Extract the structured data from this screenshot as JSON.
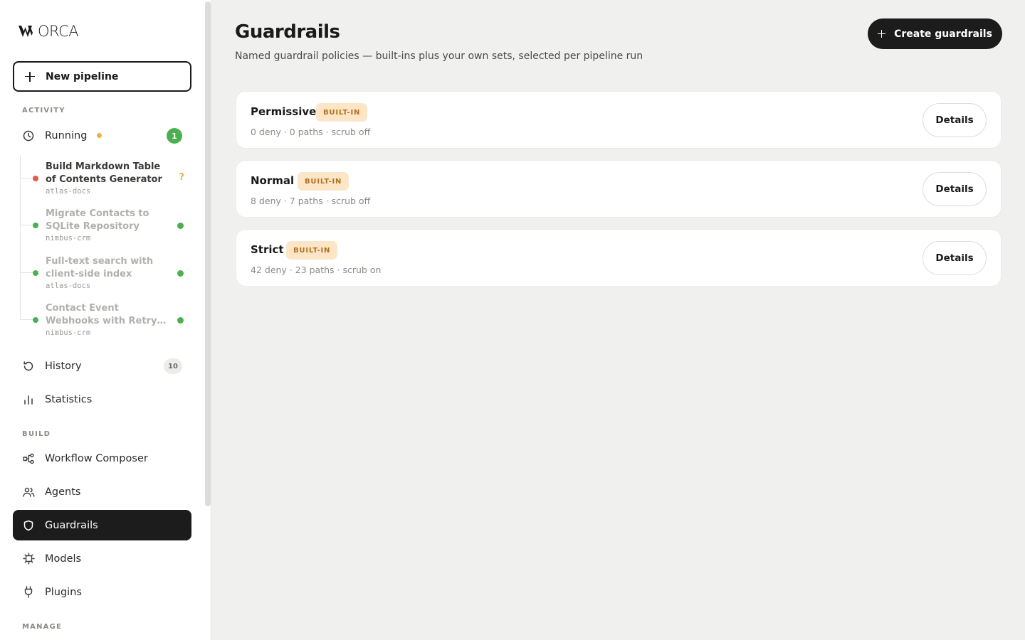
{
  "app": {
    "logo_text": "ORCA"
  },
  "sidebar": {
    "new_pipeline_label": "New pipeline",
    "sections": {
      "activity": "ACTIVITY",
      "build": "BUILD",
      "manage": "MANAGE"
    },
    "running": {
      "label": "Running",
      "count": "1"
    },
    "runs": [
      {
        "title": "Build Markdown Table of Contents Generator",
        "project": "atlas-docs",
        "status": "error",
        "indicator": "?"
      },
      {
        "title": "Migrate Contacts to SQLite Repository",
        "project": "nimbus-crm",
        "status": "ok"
      },
      {
        "title": "Full-text search with client-side index",
        "project": "atlas-docs",
        "status": "ok"
      },
      {
        "title": "Contact Event Webhooks with Retry…",
        "project": "nimbus-crm",
        "status": "ok"
      }
    ],
    "history": {
      "label": "History",
      "count": "10"
    },
    "statistics": {
      "label": "Statistics"
    },
    "build_items": [
      {
        "label": "Workflow Composer",
        "icon": "workflow-icon"
      },
      {
        "label": "Agents",
        "icon": "users-icon"
      },
      {
        "label": "Guardrails",
        "icon": "shield-icon",
        "active": true
      },
      {
        "label": "Models",
        "icon": "chip-icon"
      },
      {
        "label": "Plugins",
        "icon": "plug-icon"
      }
    ]
  },
  "main": {
    "title": "Guardrails",
    "subtitle": "Named guardrail policies — built-ins plus your own sets, selected per pipeline run",
    "create_label": "Create guardrails",
    "cards": [
      {
        "name": "Permissive",
        "badge": "BUILT-IN",
        "meta": "0 deny · 0 paths · scrub off",
        "details_label": "Details"
      },
      {
        "name": "Normal",
        "badge": "BUILT-IN",
        "meta": "8 deny · 7 paths · scrub off",
        "details_label": "Details"
      },
      {
        "name": "Strict",
        "badge": "BUILT-IN",
        "meta": "42 deny · 23 paths · scrub on",
        "details_label": "Details"
      }
    ]
  },
  "colors": {
    "accent_dark": "#1c1c1c",
    "status_ok": "#4caf50",
    "status_error": "#e05a4f",
    "status_running": "#f0ad4e",
    "badge_bg": "#fce6c7",
    "badge_text": "#b3701c"
  }
}
